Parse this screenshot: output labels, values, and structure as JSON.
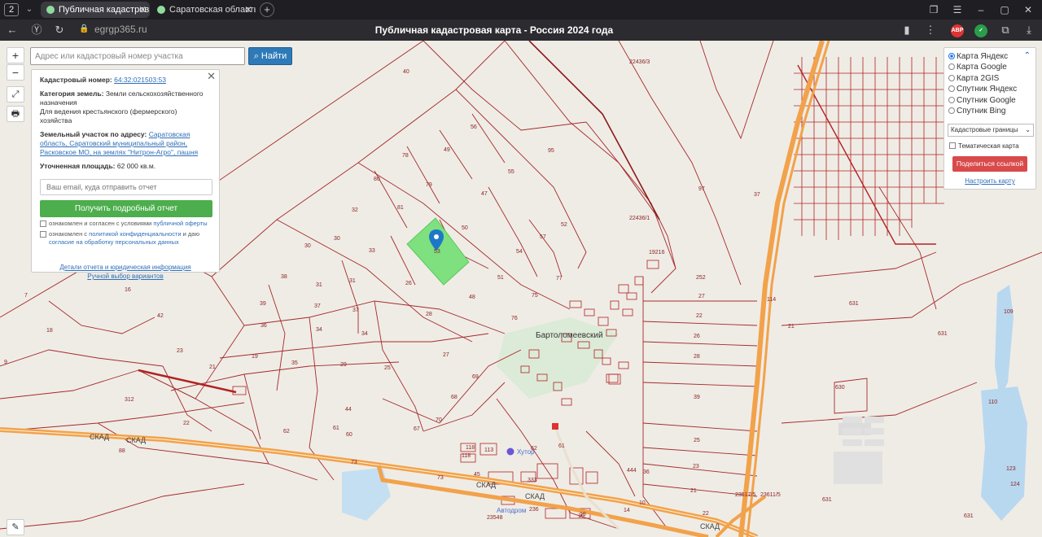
{
  "browser": {
    "tab_count": "2",
    "tabs": [
      {
        "label": "Публичная кадастров"
      },
      {
        "label": "Саратовская область, Сар"
      }
    ],
    "url": "egrgp365.ru",
    "page_title": "Публичная кадастровая карта - Россия 2024 года",
    "ext_abp": "ABP"
  },
  "map_controls": {
    "zoom_in": "+",
    "zoom_out": "−"
  },
  "search": {
    "placeholder": "Адрес или кадастровый номер участка",
    "button": "Найти"
  },
  "info": {
    "cad_label": "Кадастровый номер:",
    "cad_value": "64:32:021503:53",
    "category_label": "Категория земель:",
    "category_value": "Земли сельскохозяйственного назначения",
    "usage": "Для ведения крестьянского (фермерского) хозяйства",
    "address_label": "Земельный участок по адресу:",
    "address_value": "Саратовская область, Саратовский муниципальный район, Расковское МО, на землях \"Нитрон-Агро\", пашня",
    "area_label": "Уточненная площадь:",
    "area_value": "62 000 кв.м.",
    "email_placeholder": "Ваш email, куда отправить отчет",
    "report_button": "Получить подробный отчет",
    "consent1_text": "ознакомлен и согласен с условиями ",
    "consent1_link": "публичной оферты",
    "consent2_text": "ознакомлен с ",
    "consent2_link1": "политикой конфиденциальности",
    "consent2_mid": " и даю",
    "consent2_link2": "согласие на обработку персональных данных",
    "details_link": "Детали отчета и юридическая информация",
    "manual_link": "Ручной выбор вариантов"
  },
  "layers": {
    "options": [
      "Карта Яндекс",
      "Карта Google",
      "Карта 2GIS",
      "Спутник Яндекс",
      "Спутник Google",
      "Спутник Bing"
    ],
    "selected": "Карта Яндекс",
    "boundary_select": "Кадастровые границы",
    "thematic": "Тематическая карта",
    "share": "Поделиться ссылкой",
    "configure": "Настроить карту"
  },
  "map_labels": {
    "village": "Бартоломеевский",
    "road_skad": "СКАД",
    "hutor": "Хутор",
    "autodrom": "Автодром",
    "selected_parcel": "53",
    "parcel_numbers": [
      "40",
      "56",
      "95",
      "49",
      "55",
      "78",
      "80",
      "79",
      "47",
      "97",
      "37",
      "32",
      "81",
      "50",
      "52",
      "30",
      "30",
      "33",
      "57",
      "54",
      "38",
      "31",
      "31",
      "26",
      "51",
      "77",
      "39",
      "37",
      "37",
      "28",
      "48",
      "75",
      "36",
      "34",
      "34",
      "76",
      "23",
      "19",
      "35",
      "29",
      "25",
      "27",
      "21",
      "69",
      "312",
      "44",
      "68",
      "22",
      "62",
      "61",
      "60",
      "67",
      "70",
      "88",
      "73",
      "252",
      "27",
      "22",
      "26",
      "28",
      "39",
      "25",
      "23",
      "21",
      "631",
      "631",
      "109",
      "630",
      "110",
      "123",
      "124",
      "631",
      "631",
      "16",
      "7",
      "42",
      "18",
      "9",
      "113",
      "118",
      "45",
      "62",
      "61",
      "444",
      "36",
      "19",
      "16",
      "14",
      "10",
      "236",
      "23548",
      "333",
      "73",
      "22",
      "21",
      "22436/1",
      "22436/3",
      "19216",
      "23517/5",
      "23611/5",
      "114",
      "118"
    ]
  },
  "colors": {
    "parcel_line": "#a52a2a",
    "selected_fill": "#7ee07e",
    "road": "#f2a24a",
    "water": "#b8d8f0",
    "accent_blue": "#2e7ab8",
    "share_red": "#d94a4a",
    "report_green": "#4cae4c"
  }
}
